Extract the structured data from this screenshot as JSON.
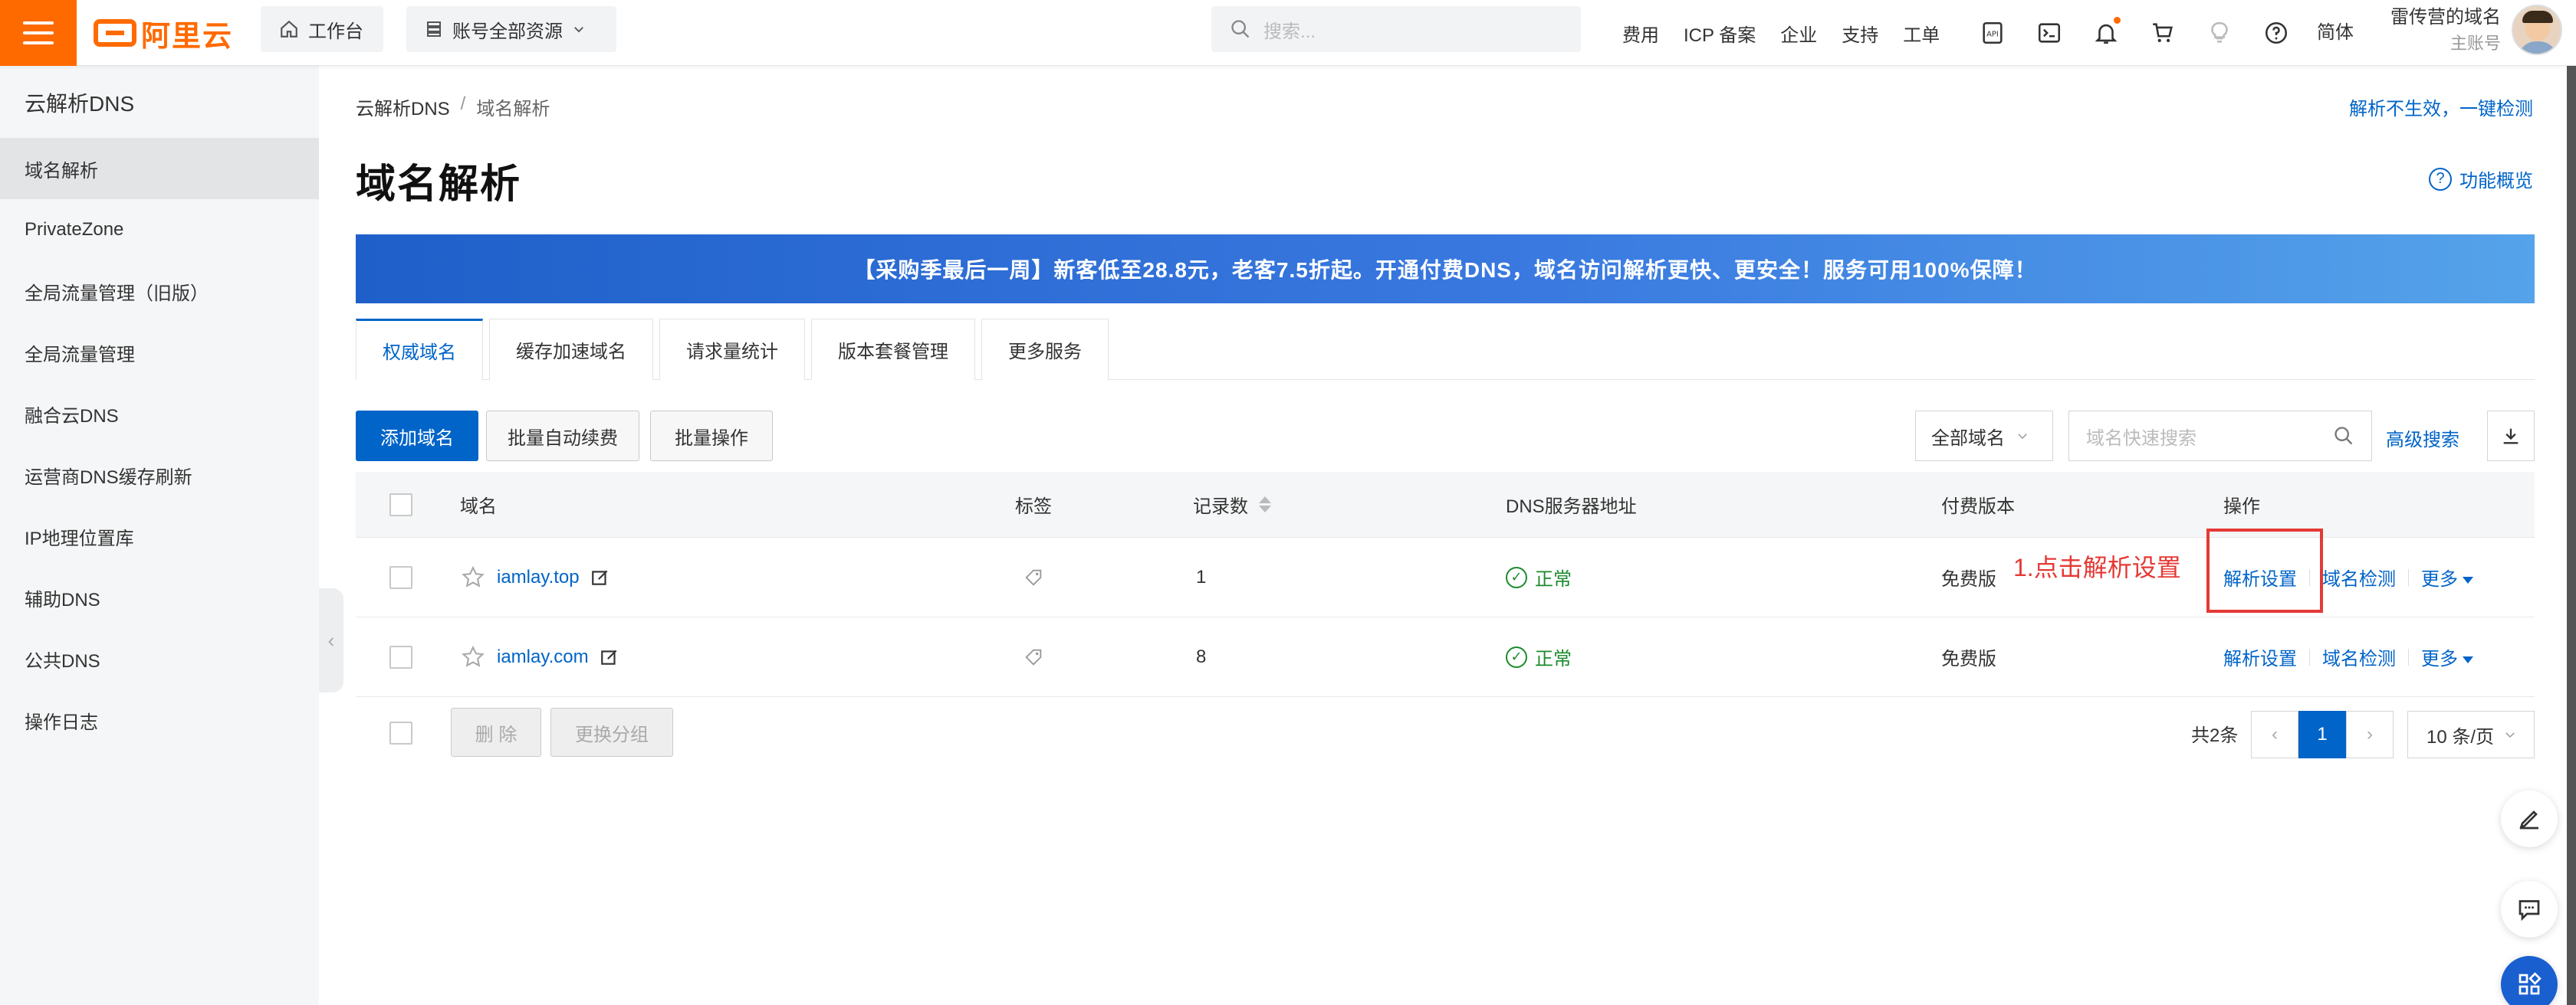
{
  "topbar": {
    "logo_text": "阿里云",
    "workbench": "工作台",
    "account_resources": "账号全部资源",
    "search_placeholder": "搜索...",
    "links": [
      "费用",
      "ICP 备案",
      "企业",
      "支持",
      "工单"
    ],
    "language": "简体",
    "user_name": "雷传营的域名",
    "user_role": "主账号"
  },
  "sidebar": {
    "title": "云解析DNS",
    "items": [
      {
        "label": "域名解析",
        "active": true
      },
      {
        "label": "PrivateZone",
        "active": false
      },
      {
        "label": "全局流量管理（旧版）",
        "active": false
      },
      {
        "label": "全局流量管理",
        "active": false
      },
      {
        "label": "融合云DNS",
        "active": false
      },
      {
        "label": "运营商DNS缓存刷新",
        "active": false
      },
      {
        "label": "IP地理位置库",
        "active": false
      },
      {
        "label": "辅助DNS",
        "active": false
      },
      {
        "label": "公共DNS",
        "active": false
      },
      {
        "label": "操作日志",
        "active": false
      }
    ]
  },
  "main": {
    "breadcrumb": [
      "云解析DNS",
      "域名解析"
    ],
    "breadcrumb_sep": "/",
    "top_right_link": "解析不生效，一键检测",
    "title": "域名解析",
    "overview_link": "功能概览",
    "banner": "【采购季最后一周】新客低至28.8元，老客7.5折起。开通付费DNS，域名访问解析更快、更安全！服务可用100%保障！",
    "tabs": [
      {
        "label": "权威域名",
        "active": true
      },
      {
        "label": "缓存加速域名",
        "active": false
      },
      {
        "label": "请求量统计",
        "active": false
      },
      {
        "label": "版本套餐管理",
        "active": false
      },
      {
        "label": "更多服务",
        "active": false
      }
    ],
    "toolbar": {
      "add_domain": "添加域名",
      "batch_renew": "批量自动续费",
      "batch_ops": "批量操作",
      "domain_filter": "全部域名",
      "search_placeholder": "域名快速搜索",
      "advanced_search": "高级搜索"
    },
    "table": {
      "columns": [
        "域名",
        "标签",
        "记录数",
        "DNS服务器地址",
        "付费版本",
        "操作"
      ],
      "rows": [
        {
          "domain": "iamlay.top",
          "records": "1",
          "dns_status": "正常",
          "edition": "免费版",
          "op_resolve": "解析设置",
          "op_check": "域名检测",
          "op_more": "更多"
        },
        {
          "domain": "iamlay.com",
          "records": "8",
          "dns_status": "正常",
          "edition": "免费版",
          "op_resolve": "解析设置",
          "op_check": "域名检测",
          "op_more": "更多"
        }
      ]
    },
    "annotation": "1.点击解析设置",
    "footer": {
      "delete": "删 除",
      "change_group": "更换分组",
      "total": "共2条",
      "current_page": "1",
      "page_size": "10 条/页"
    }
  },
  "colors": {
    "brand_orange": "#ff6a00",
    "link_blue": "#0064c8",
    "status_green": "#1c8a2e",
    "annotation_red": "#e53935"
  }
}
